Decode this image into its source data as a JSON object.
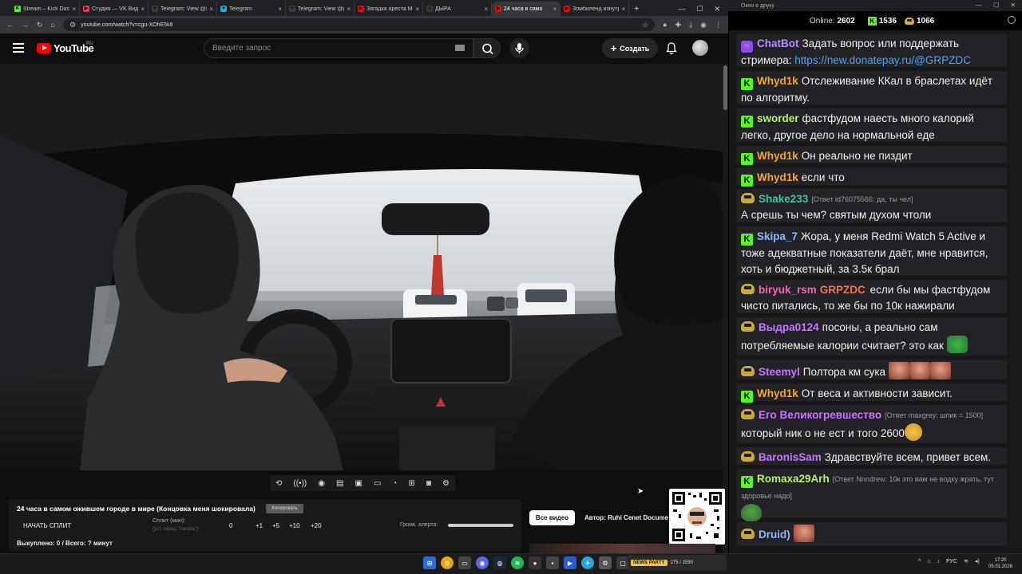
{
  "browser": {
    "tabs": [
      {
        "label": "Stream – Kick Dashb",
        "fav": "K",
        "fav_color": "#53fc18",
        "active": false
      },
      {
        "label": "Студия — VK Видео",
        "fav": "▶",
        "fav_color": "#ff3347",
        "active": false
      },
      {
        "label": "Telegram: View @s",
        "fav": "✈",
        "fav_color": "#3a3a3a",
        "active": false
      },
      {
        "label": "Telegram",
        "fav": "✈",
        "fav_color": "#2aa3e0",
        "active": false
      },
      {
        "label": "Telegram: View @g",
        "fav": "✈",
        "fav_color": "#3a3a3a",
        "active": false
      },
      {
        "label": "Загадка ареста Ma",
        "fav": "▶",
        "fav_color": "#ff0000",
        "active": false
      },
      {
        "label": "ДЫРА",
        "fav": "◎",
        "fav_color": "#3a3a3a",
        "active": false
      },
      {
        "label": "24 часа в само",
        "fav": "▶",
        "fav_color": "#ff0000",
        "active": true
      },
      {
        "label": "Зомбиленд изнутр",
        "fav": "▶",
        "fav_color": "#ff0000",
        "active": false
      }
    ],
    "url": "youtube.com/watch?v=cgu-XOhE5k8"
  },
  "youtube": {
    "logo_text": "YouTube",
    "region": "RU",
    "search_placeholder": "Введите запрос",
    "create_label": "Создать"
  },
  "panel": {
    "video_title": "24 часа в самом ожившем городе в мире (Концовка меня шокировала)",
    "copy_label": "Копировать",
    "start_split_label": "НАЧАТЬ СПЛИТ",
    "split_label": "Сплит (мин):",
    "split_hint": "(уст. перед \"Начать\")",
    "split_buttons": [
      "0",
      "+1",
      "+5",
      "+10",
      "+20"
    ],
    "volume_label": "Громк. алерта:",
    "completed_text": "Выкуплено: 0 / Всего: ? минут",
    "all_videos_label": "Все видео",
    "author_text": "Автор: Ruhi Cenet Docume"
  },
  "taskbar": {
    "widget_badge": "NEWS PARTY",
    "widget_text": "275 / 1590",
    "lang": "РУС",
    "time": "17:20",
    "date": "05.01.2026"
  },
  "chat": {
    "window_title": "Окно в друку",
    "online_label": "Online:",
    "online_count": "2602",
    "kick_count": "1536",
    "other_count": "1066",
    "messages": [
      {
        "badge": "bot",
        "nick": "ChatBot",
        "color": "#b48cff",
        "text": "Задать вопрос или поддержать стримера: ",
        "link": "https://new.donatepay.ru/@GRPZDC"
      },
      {
        "badge": "kick",
        "nick": "Whyd1k",
        "color": "#f6a623",
        "text": "Отслеживание ККал в браслетах идёт по алгоритму."
      },
      {
        "badge": "kick",
        "nick": "sworder",
        "color": "#b2f36b",
        "text": "фастфудом наесть много калорий легко, другое дело на нормальной еде"
      },
      {
        "badge": "kick",
        "nick": "Whyd1k",
        "color": "#f6a623",
        "text": "Он реально не пиздит"
      },
      {
        "badge": "kick",
        "nick": "Whyd1k",
        "color": "#f6a623",
        "text": "если что"
      },
      {
        "badge": "gold",
        "nick": "Shake233",
        "color": "#3cc9a0",
        "reply": "[Ответ id76075566: да, ты чел]",
        "text": "А срешь ты чем? святым духом чтоли"
      },
      {
        "badge": "kick",
        "nick": "Skipa_7",
        "color": "#8fb8ff",
        "text": "Жора, у меня Redmi Watch 5 Active и тоже адекватные показатели даёт, мне нравится, хоть и бюджетный, за 3.5к брал"
      },
      {
        "badge": "gold",
        "nick": "biryuk_rsm",
        "color": "#ff5fb3",
        "mention": "GRPZDC",
        "mention_color": "#ff7043",
        "text": "если бы мы фастфудом чисто питались, то же бы по 10к нажирали"
      },
      {
        "badge": "gold",
        "nick": "Выдра0124",
        "color": "#c774ff",
        "text": "посоны, а реально сам потребляемые калории считает? это как"
      },
      {
        "badge": "gold",
        "nick": "Steemyl",
        "color": "#c774ff",
        "text": "Полтора км сука"
      },
      {
        "badge": "kick",
        "nick": "Whyd1k",
        "color": "#f6a623",
        "text": "От веса и активности зависит."
      },
      {
        "badge": "gold",
        "nick": "Его Великогревшество",
        "color": "#c774ff",
        "reply": "[Ответ maxgrey: шпик = 1500]",
        "text": "который ник о не ест и того 2600"
      },
      {
        "badge": "gold",
        "nick": "BaronisSam",
        "color": "#c774ff",
        "text": "Здравствуйте всем, привет всем."
      },
      {
        "badge": "kick",
        "nick": "Romaxa29Arh",
        "color": "#b2f36b",
        "reply": "[Ответ Nnndrew: 10к это вам не водку жрать, тут здоровье надо]",
        "text": ""
      },
      {
        "badge": "gold",
        "nick": "Druid)",
        "color": "#8fb8ff",
        "text": ""
      }
    ]
  }
}
